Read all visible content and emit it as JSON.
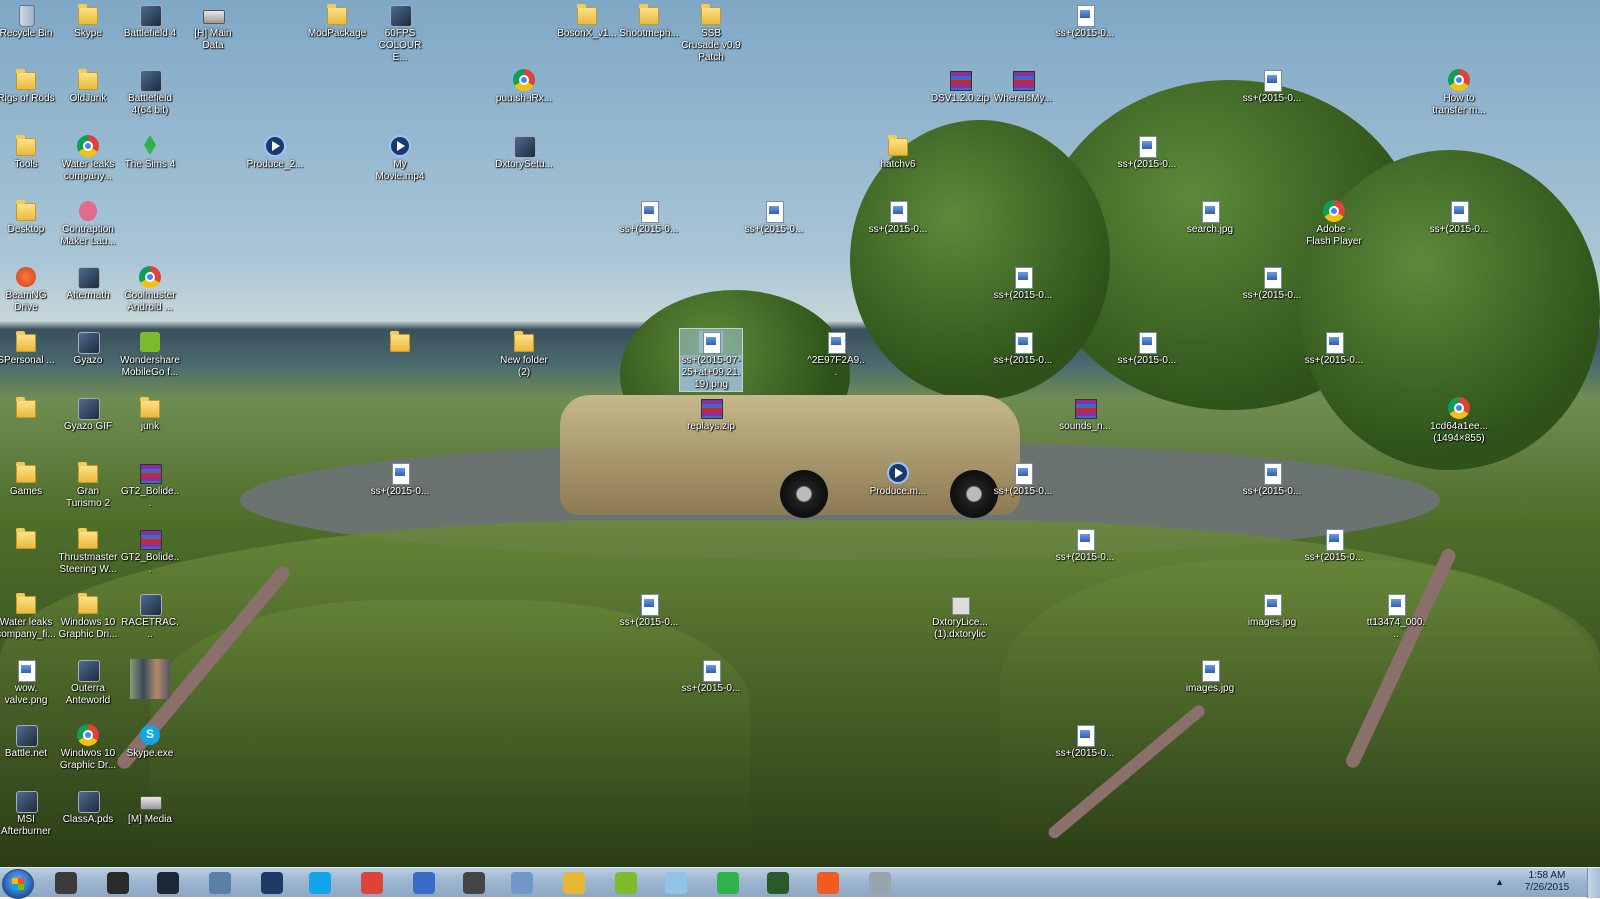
{
  "desktop": {
    "icons": [
      {
        "id": "recycle-bin",
        "label": "Recycle Bin",
        "type": "recycle"
      },
      {
        "id": "skype-folder",
        "label": "Skype",
        "type": "folder"
      },
      {
        "id": "battlefield4",
        "label": "Battlefield 4",
        "type": "app"
      },
      {
        "id": "main-data",
        "label": "[H] Main Data",
        "type": "drive"
      },
      {
        "id": "modpackage",
        "label": "ModPackage",
        "type": "folder"
      },
      {
        "id": "60fps",
        "label": "60FPS COLOUR E...",
        "type": "app"
      },
      {
        "id": "bosonx",
        "label": "BosonX_v1...",
        "type": "folder"
      },
      {
        "id": "shootmeph",
        "label": "Shootmeph...",
        "type": "folder"
      },
      {
        "id": "ssb-crusade",
        "label": "SSB Crusade v0.9 Patch",
        "type": "folder"
      },
      {
        "id": "ss-r1-c17",
        "label": "ss+(2015-0...",
        "type": "doc"
      },
      {
        "id": "rigs-of-rods",
        "label": "Rigs of Rods",
        "type": "folder"
      },
      {
        "id": "oldjunk",
        "label": "OldJunk",
        "type": "folder"
      },
      {
        "id": "battlefield4-64",
        "label": "Battlefield 4(64 bit)",
        "type": "app"
      },
      {
        "id": "puush",
        "label": "puu.sh-iRx...",
        "type": "chrome"
      },
      {
        "id": "dsv1",
        "label": "DSV1.2.0.zip",
        "type": "zip"
      },
      {
        "id": "whereismy",
        "label": "WhereIsMy...",
        "type": "zip"
      },
      {
        "id": "ss-r2-c20",
        "label": "ss+(2015-0...",
        "type": "doc"
      },
      {
        "id": "how-to-transfer",
        "label": "How to transfer m...",
        "type": "chrome"
      },
      {
        "id": "tools",
        "label": "Tools",
        "type": "folder"
      },
      {
        "id": "water-leaks-company",
        "label": "Water leaks company...",
        "type": "chrome"
      },
      {
        "id": "the-sims-4",
        "label": "The Sims 4",
        "type": "sims"
      },
      {
        "id": "produce-2",
        "label": "Produce_2...",
        "type": "video"
      },
      {
        "id": "my-movie",
        "label": "My Movie.mp4",
        "type": "video"
      },
      {
        "id": "dxtory-setup",
        "label": "DxtorySetu...",
        "type": "app"
      },
      {
        "id": "hatchv6",
        "label": "hatchv6",
        "type": "folder"
      },
      {
        "id": "ss-r3-c18",
        "label": "ss+(2015-0...",
        "type": "doc"
      },
      {
        "id": "desktop-folder",
        "label": "Desktop",
        "type": "folder"
      },
      {
        "id": "contraption-maker",
        "label": "Contraption Maker Lau...",
        "type": "pink"
      },
      {
        "id": "ss-r4-c10",
        "label": "ss+(2015-0...",
        "type": "doc"
      },
      {
        "id": "ss-r4-c12",
        "label": "ss+(2015-0...",
        "type": "doc"
      },
      {
        "id": "ss-r4-c14",
        "label": "ss+(2015-0...",
        "type": "doc"
      },
      {
        "id": "search-jpg",
        "label": "search.jpg",
        "type": "doc"
      },
      {
        "id": "adobe-flash",
        "label": "Adobe - Flash Player",
        "type": "chrome"
      },
      {
        "id": "ss-r4-c23",
        "label": "ss+(2015-0...",
        "type": "doc"
      },
      {
        "id": "beamng",
        "label": "BeamNG Drive",
        "type": "orange"
      },
      {
        "id": "aftermath",
        "label": "Aftermath",
        "type": "app"
      },
      {
        "id": "coolmuster",
        "label": "Coolmuster Android ...",
        "type": "chrome"
      },
      {
        "id": "ss-r5-c16",
        "label": "ss+(2015-0...",
        "type": "doc"
      },
      {
        "id": "ss-r5-c20",
        "label": "ss+(2015-0...",
        "type": "doc"
      },
      {
        "id": "personal",
        "label": "SPersonal ...",
        "type": "folder"
      },
      {
        "id": "gyazo",
        "label": "Gyazo",
        "type": "app"
      },
      {
        "id": "wondershare",
        "label": "Wondershare MobileGo f...",
        "type": "green"
      },
      {
        "id": "blank-folder",
        "label": "",
        "type": "folder"
      },
      {
        "id": "new-folder-2",
        "label": "New folder (2)",
        "type": "folder"
      },
      {
        "id": "ss-selected",
        "label": "ss+(2015-07-25+at+09.21.19).png",
        "type": "doc",
        "selected": true
      },
      {
        "id": "2e97f2a9",
        "label": "^2E97F2A9...",
        "type": "doc"
      },
      {
        "id": "ss-r6-c16",
        "label": "ss+(2015-0...",
        "type": "doc"
      },
      {
        "id": "ss-r6-c18",
        "label": "ss+(2015-0...",
        "type": "doc"
      },
      {
        "id": "ss-r6-c21",
        "label": "ss+(2015-0...",
        "type": "doc"
      },
      {
        "id": "blank-folder-2",
        "label": "",
        "type": "folder"
      },
      {
        "id": "gyazo-gif",
        "label": "Gyazo GIF",
        "type": "app"
      },
      {
        "id": "junk",
        "label": "junk",
        "type": "folder"
      },
      {
        "id": "replays-zip",
        "label": "replays.zip",
        "type": "zip"
      },
      {
        "id": "sounds",
        "label": "sounds_n...",
        "type": "zip"
      },
      {
        "id": "chrome-1cd64",
        "label": "1cd64a1ee... (1494×855)",
        "type": "chrome"
      },
      {
        "id": "games",
        "label": "Games",
        "type": "folder"
      },
      {
        "id": "gran-turismo",
        "label": "Gran Turismo 2",
        "type": "folder"
      },
      {
        "id": "gt2-bolide-1",
        "label": "GT2_Bolide...",
        "type": "zip"
      },
      {
        "id": "ss-r8-c6",
        "label": "ss+(2015-0...",
        "type": "doc"
      },
      {
        "id": "produce-m",
        "label": "Produce.m...",
        "type": "video"
      },
      {
        "id": "ss-r8-c16",
        "label": "ss+(2015-0...",
        "type": "doc"
      },
      {
        "id": "ss-r8-c20",
        "label": "ss+(2015-0...",
        "type": "doc"
      },
      {
        "id": "blank-folder-3",
        "label": "",
        "type": "folder"
      },
      {
        "id": "thrustmaster",
        "label": "Thrustmaster Steering W...",
        "type": "folder"
      },
      {
        "id": "gt2-bolide-2",
        "label": "GT2_Bolide...",
        "type": "zip"
      },
      {
        "id": "ss-r9-c17",
        "label": "ss+(2015-0...",
        "type": "doc"
      },
      {
        "id": "ss-r9-c21",
        "label": "ss+(2015-0...",
        "type": "doc"
      },
      {
        "id": "water-leaks-fi",
        "label": "Water leaks company_fi...",
        "type": "folder"
      },
      {
        "id": "windows10-graphic-1",
        "label": "Windows 10 Graphic Dri...",
        "type": "folder"
      },
      {
        "id": "racetrac",
        "label": "RACETRAC...",
        "type": "app"
      },
      {
        "id": "ss-r10-c10",
        "label": "ss+(2015-0...",
        "type": "doc"
      },
      {
        "id": "dxtory-ce",
        "label": "DxtoryLice... (1).dxtorylic",
        "type": "blank"
      },
      {
        "id": "images-jpg-1",
        "label": "images.jpg",
        "type": "doc"
      },
      {
        "id": "tt13474",
        "label": "tt13474_000...",
        "type": "doc"
      },
      {
        "id": "wow-valve",
        "label": "wow, valve.png",
        "type": "doc"
      },
      {
        "id": "outerra",
        "label": "Outerra Anteworld",
        "type": "app"
      },
      {
        "id": "thumb-image",
        "label": "",
        "type": "thumb"
      },
      {
        "id": "ss-r11-c11",
        "label": "ss+(2015-0...",
        "type": "doc"
      },
      {
        "id": "images-jpg-2",
        "label": "images.jpg",
        "type": "doc"
      },
      {
        "id": "battle-net",
        "label": "Battle.net",
        "type": "app"
      },
      {
        "id": "windows10-graphic-2",
        "label": "Windwos 10 Graphic Dr...",
        "type": "chrome"
      },
      {
        "id": "skype-exe",
        "label": "Skype.exe",
        "type": "skype"
      },
      {
        "id": "ss-r12-c17",
        "label": "ss+(2015-0...",
        "type": "doc"
      },
      {
        "id": "msi-afterburner",
        "label": "MSI Afterburner",
        "type": "app"
      },
      {
        "id": "classa-pds",
        "label": "ClassA.pds",
        "type": "app"
      },
      {
        "id": "m-media",
        "label": "[M] Media",
        "type": "drive"
      }
    ]
  },
  "taskbar": {
    "start_label": "Start",
    "pinned": [
      {
        "id": "steam-alt",
        "icon": "gamepad-icon",
        "color": "#3b3b3b"
      },
      {
        "id": "obs",
        "icon": "record-icon",
        "color": "#2a2a2a"
      },
      {
        "id": "steam",
        "icon": "steam-icon",
        "color": "#1b2838"
      },
      {
        "id": "printer",
        "icon": "printer-icon",
        "color": "#5a7fa8"
      },
      {
        "id": "media-center",
        "icon": "monitor-icon",
        "color": "#1d3b66"
      },
      {
        "id": "skype",
        "icon": "skype-icon",
        "color": "#12a5e7"
      },
      {
        "id": "chrome",
        "icon": "chrome-icon",
        "color": "#db4437"
      },
      {
        "id": "gyazo",
        "icon": "pen-icon",
        "color": "#3a6bc9"
      },
      {
        "id": "camera",
        "icon": "camera-icon",
        "color": "#444444"
      },
      {
        "id": "control-panel",
        "icon": "window-icon",
        "color": "#6f98c8"
      },
      {
        "id": "explorer",
        "icon": "folder-icon",
        "color": "#e8b73a"
      },
      {
        "id": "notepad",
        "icon": "notepad-icon",
        "color": "#7dbb2b"
      },
      {
        "id": "paint",
        "icon": "paint-icon",
        "color": "#8fc3e8"
      },
      {
        "id": "xbox",
        "icon": "globe-icon",
        "color": "#2db34a"
      },
      {
        "id": "task-manager",
        "icon": "chart-icon",
        "color": "#2a5a2a"
      },
      {
        "id": "beamng",
        "icon": "beamng-icon",
        "color": "#f25a22"
      },
      {
        "id": "disc",
        "icon": "disc-icon",
        "color": "#9aa4ae"
      }
    ],
    "clock": {
      "time": "1:58 AM",
      "date": "7/26/2015"
    },
    "tray_arrow": "▲"
  }
}
